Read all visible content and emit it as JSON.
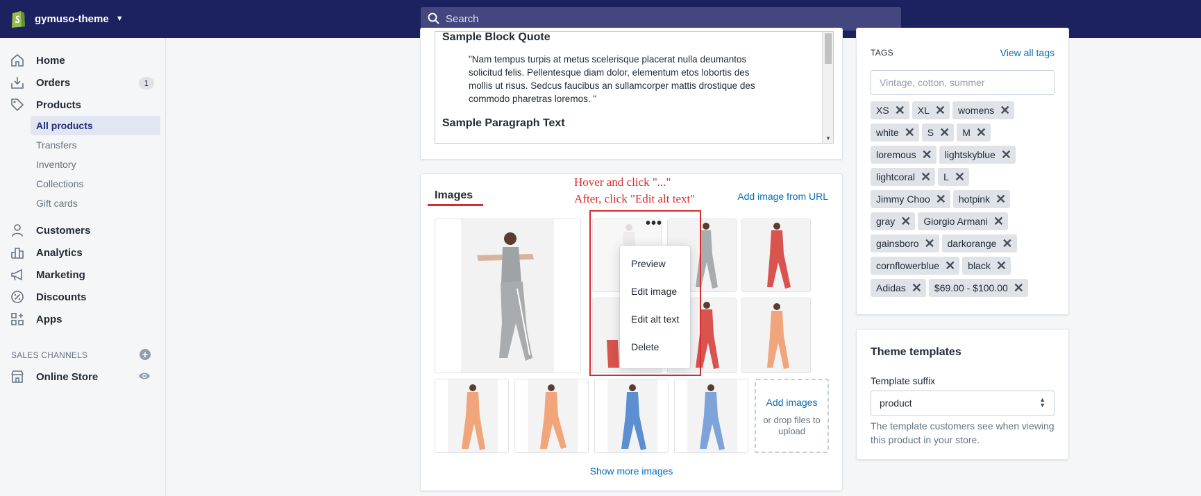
{
  "topbar": {
    "store_name": "gymuso-theme",
    "search_placeholder": "Search"
  },
  "sidebar": {
    "items": [
      {
        "label": "Home"
      },
      {
        "label": "Orders",
        "badge": "1"
      },
      {
        "label": "Products"
      },
      {
        "label": "Customers"
      },
      {
        "label": "Analytics"
      },
      {
        "label": "Marketing"
      },
      {
        "label": "Discounts"
      },
      {
        "label": "Apps"
      }
    ],
    "product_subitems": [
      "All products",
      "Transfers",
      "Inventory",
      "Collections",
      "Gift cards"
    ],
    "sales_channels_title": "SALES CHANNELS",
    "online_store": "Online Store"
  },
  "editor": {
    "heading1": "Sample Block Quote",
    "quote": "\"Nam tempus turpis at metus scelerisque placerat nulla deumantos solicitud felis. Pellentesque diam dolor, elementum etos lobortis des mollis ut risus. Sedcus faucibus an sullamcorper mattis drostique des commodo pharetras loremos. \"",
    "heading2": "Sample Paragraph Text"
  },
  "images": {
    "title": "Images",
    "add_from_url": "Add image from URL",
    "annotation_line1": "Hover and click \"...\"",
    "annotation_line2": "After, click \"Edit alt text\"",
    "menu": [
      "Preview",
      "Edit image",
      "Edit alt text",
      "Delete"
    ],
    "more_dots": "•••",
    "add_images": "Add images",
    "drop_files": "or drop files to upload",
    "show_more": "Show more images"
  },
  "tags": {
    "label": "TAGS",
    "view_all": "View all tags",
    "placeholder": "Vintage, cotton, summer",
    "rows": [
      [
        "XS",
        "XL",
        "womens"
      ],
      [
        "white",
        "S",
        "M"
      ],
      [
        "loremous",
        "lightskyblue"
      ],
      [
        "lightcoral",
        "L"
      ],
      [
        "Jimmy Choo",
        "hotpink"
      ],
      [
        "gray",
        "Giorgio Armani"
      ],
      [
        "gainsboro",
        "darkorange"
      ],
      [
        "cornflowerblue",
        "black"
      ],
      [
        "Adidas",
        "$69.00 - $100.00"
      ]
    ]
  },
  "theme": {
    "title": "Theme templates",
    "suffix_label": "Template suffix",
    "suffix_value": "product",
    "help": "The template customers see when viewing this product in your store."
  },
  "colors": {
    "topbar": "#1c2260",
    "link": "#006fbb",
    "annotation": "#d82c2c",
    "active_nav_bg": "#e2e6f3"
  }
}
